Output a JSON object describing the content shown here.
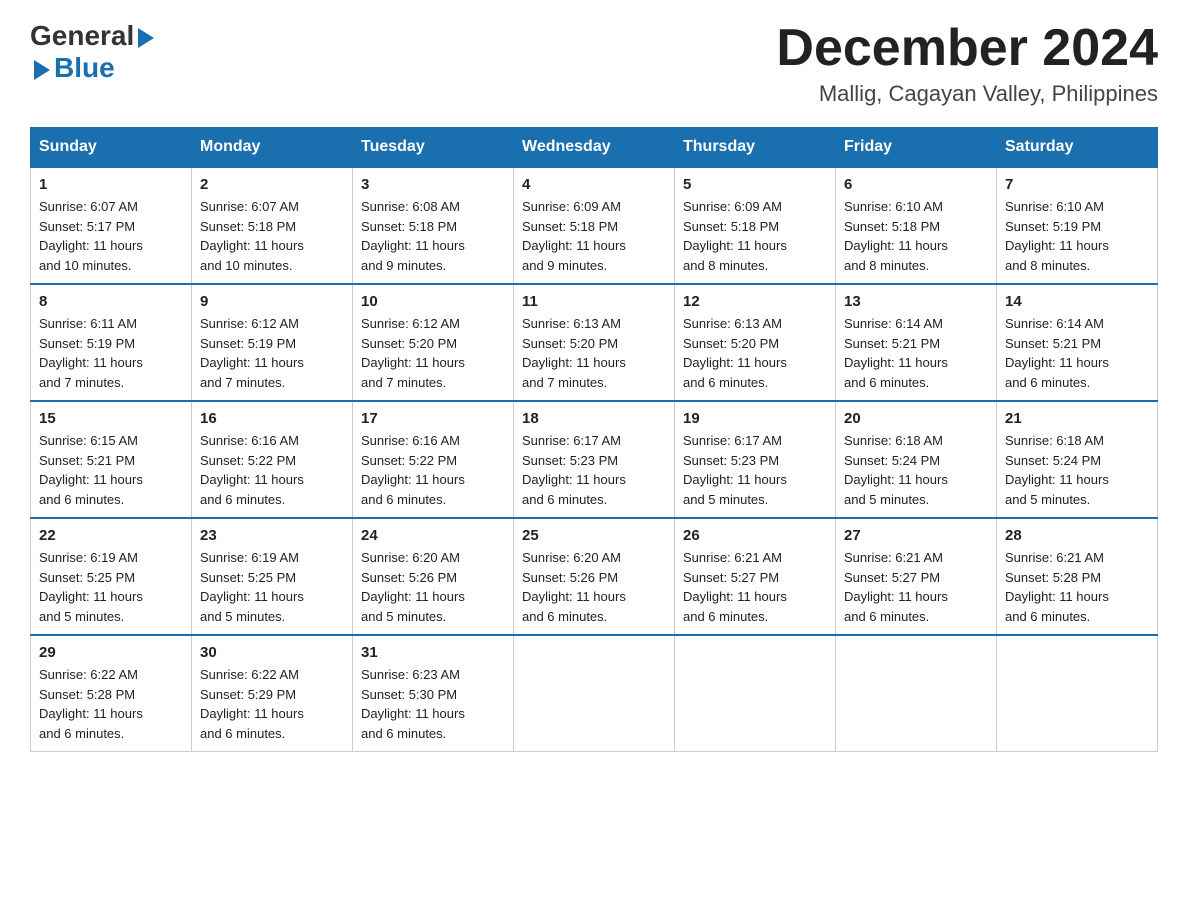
{
  "header": {
    "logo_general": "General",
    "logo_blue": "Blue",
    "month_title": "December 2024",
    "location": "Mallig, Cagayan Valley, Philippines"
  },
  "weekdays": [
    "Sunday",
    "Monday",
    "Tuesday",
    "Wednesday",
    "Thursday",
    "Friday",
    "Saturday"
  ],
  "weeks": [
    [
      {
        "day": "1",
        "sunrise": "6:07 AM",
        "sunset": "5:17 PM",
        "daylight": "11 hours and 10 minutes."
      },
      {
        "day": "2",
        "sunrise": "6:07 AM",
        "sunset": "5:18 PM",
        "daylight": "11 hours and 10 minutes."
      },
      {
        "day": "3",
        "sunrise": "6:08 AM",
        "sunset": "5:18 PM",
        "daylight": "11 hours and 9 minutes."
      },
      {
        "day": "4",
        "sunrise": "6:09 AM",
        "sunset": "5:18 PM",
        "daylight": "11 hours and 9 minutes."
      },
      {
        "day": "5",
        "sunrise": "6:09 AM",
        "sunset": "5:18 PM",
        "daylight": "11 hours and 8 minutes."
      },
      {
        "day": "6",
        "sunrise": "6:10 AM",
        "sunset": "5:18 PM",
        "daylight": "11 hours and 8 minutes."
      },
      {
        "day": "7",
        "sunrise": "6:10 AM",
        "sunset": "5:19 PM",
        "daylight": "11 hours and 8 minutes."
      }
    ],
    [
      {
        "day": "8",
        "sunrise": "6:11 AM",
        "sunset": "5:19 PM",
        "daylight": "11 hours and 7 minutes."
      },
      {
        "day": "9",
        "sunrise": "6:12 AM",
        "sunset": "5:19 PM",
        "daylight": "11 hours and 7 minutes."
      },
      {
        "day": "10",
        "sunrise": "6:12 AM",
        "sunset": "5:20 PM",
        "daylight": "11 hours and 7 minutes."
      },
      {
        "day": "11",
        "sunrise": "6:13 AM",
        "sunset": "5:20 PM",
        "daylight": "11 hours and 7 minutes."
      },
      {
        "day": "12",
        "sunrise": "6:13 AM",
        "sunset": "5:20 PM",
        "daylight": "11 hours and 6 minutes."
      },
      {
        "day": "13",
        "sunrise": "6:14 AM",
        "sunset": "5:21 PM",
        "daylight": "11 hours and 6 minutes."
      },
      {
        "day": "14",
        "sunrise": "6:14 AM",
        "sunset": "5:21 PM",
        "daylight": "11 hours and 6 minutes."
      }
    ],
    [
      {
        "day": "15",
        "sunrise": "6:15 AM",
        "sunset": "5:21 PM",
        "daylight": "11 hours and 6 minutes."
      },
      {
        "day": "16",
        "sunrise": "6:16 AM",
        "sunset": "5:22 PM",
        "daylight": "11 hours and 6 minutes."
      },
      {
        "day": "17",
        "sunrise": "6:16 AM",
        "sunset": "5:22 PM",
        "daylight": "11 hours and 6 minutes."
      },
      {
        "day": "18",
        "sunrise": "6:17 AM",
        "sunset": "5:23 PM",
        "daylight": "11 hours and 6 minutes."
      },
      {
        "day": "19",
        "sunrise": "6:17 AM",
        "sunset": "5:23 PM",
        "daylight": "11 hours and 5 minutes."
      },
      {
        "day": "20",
        "sunrise": "6:18 AM",
        "sunset": "5:24 PM",
        "daylight": "11 hours and 5 minutes."
      },
      {
        "day": "21",
        "sunrise": "6:18 AM",
        "sunset": "5:24 PM",
        "daylight": "11 hours and 5 minutes."
      }
    ],
    [
      {
        "day": "22",
        "sunrise": "6:19 AM",
        "sunset": "5:25 PM",
        "daylight": "11 hours and 5 minutes."
      },
      {
        "day": "23",
        "sunrise": "6:19 AM",
        "sunset": "5:25 PM",
        "daylight": "11 hours and 5 minutes."
      },
      {
        "day": "24",
        "sunrise": "6:20 AM",
        "sunset": "5:26 PM",
        "daylight": "11 hours and 5 minutes."
      },
      {
        "day": "25",
        "sunrise": "6:20 AM",
        "sunset": "5:26 PM",
        "daylight": "11 hours and 6 minutes."
      },
      {
        "day": "26",
        "sunrise": "6:21 AM",
        "sunset": "5:27 PM",
        "daylight": "11 hours and 6 minutes."
      },
      {
        "day": "27",
        "sunrise": "6:21 AM",
        "sunset": "5:27 PM",
        "daylight": "11 hours and 6 minutes."
      },
      {
        "day": "28",
        "sunrise": "6:21 AM",
        "sunset": "5:28 PM",
        "daylight": "11 hours and 6 minutes."
      }
    ],
    [
      {
        "day": "29",
        "sunrise": "6:22 AM",
        "sunset": "5:28 PM",
        "daylight": "11 hours and 6 minutes."
      },
      {
        "day": "30",
        "sunrise": "6:22 AM",
        "sunset": "5:29 PM",
        "daylight": "11 hours and 6 minutes."
      },
      {
        "day": "31",
        "sunrise": "6:23 AM",
        "sunset": "5:30 PM",
        "daylight": "11 hours and 6 minutes."
      },
      null,
      null,
      null,
      null
    ]
  ],
  "labels": {
    "sunrise": "Sunrise:",
    "sunset": "Sunset:",
    "daylight": "Daylight:"
  }
}
